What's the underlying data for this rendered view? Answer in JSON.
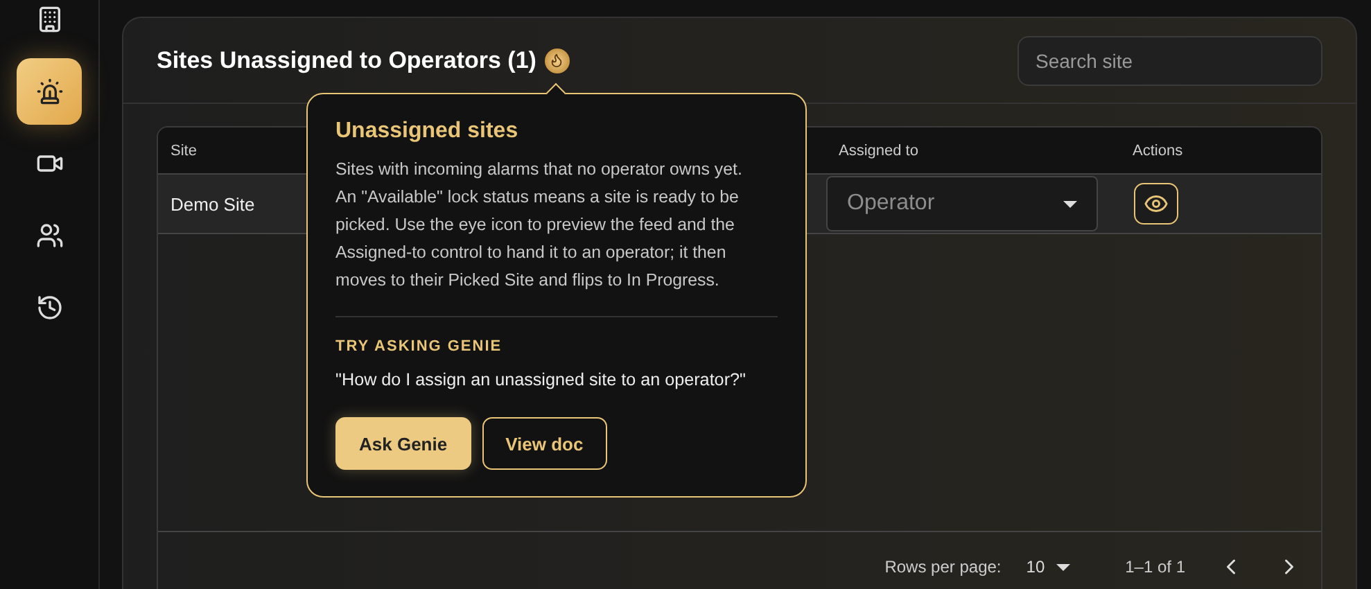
{
  "sidebar": {
    "items": [
      {
        "selected": false
      },
      {
        "selected": true
      },
      {
        "selected": false
      },
      {
        "selected": false
      },
      {
        "selected": false
      }
    ]
  },
  "panel": {
    "title": "Sites Unassigned to Operators (1)",
    "search": {
      "placeholder": "Search site"
    }
  },
  "table": {
    "columns": [
      "Site",
      "Assigned to",
      "Actions"
    ],
    "rows": [
      {
        "site": "Demo Site",
        "assigned_to": {
          "placeholder": "Operator"
        }
      }
    ],
    "footer": {
      "rows_per_page_label": "Rows per page:",
      "rows_per_page": "10",
      "range": "1–1 of 1"
    }
  },
  "tooltip": {
    "title": "Unassigned sites",
    "body": "Sites with incoming alarms that no operator owns yet. An \"Available\" lock status means a site is ready to be picked. Use the eye icon to preview the feed and the Assigned-to control to hand it to an operator; it then moves to their Picked Site and flips to In Progress.",
    "prompt_heading": "TRY ASKING GENIE",
    "prompt": "\"How do I assign an unassigned site to an operator?\"",
    "buttons": [
      {
        "label": "Ask Genie",
        "kind": "primary"
      },
      {
        "label": "View doc",
        "kind": "outline"
      }
    ]
  }
}
